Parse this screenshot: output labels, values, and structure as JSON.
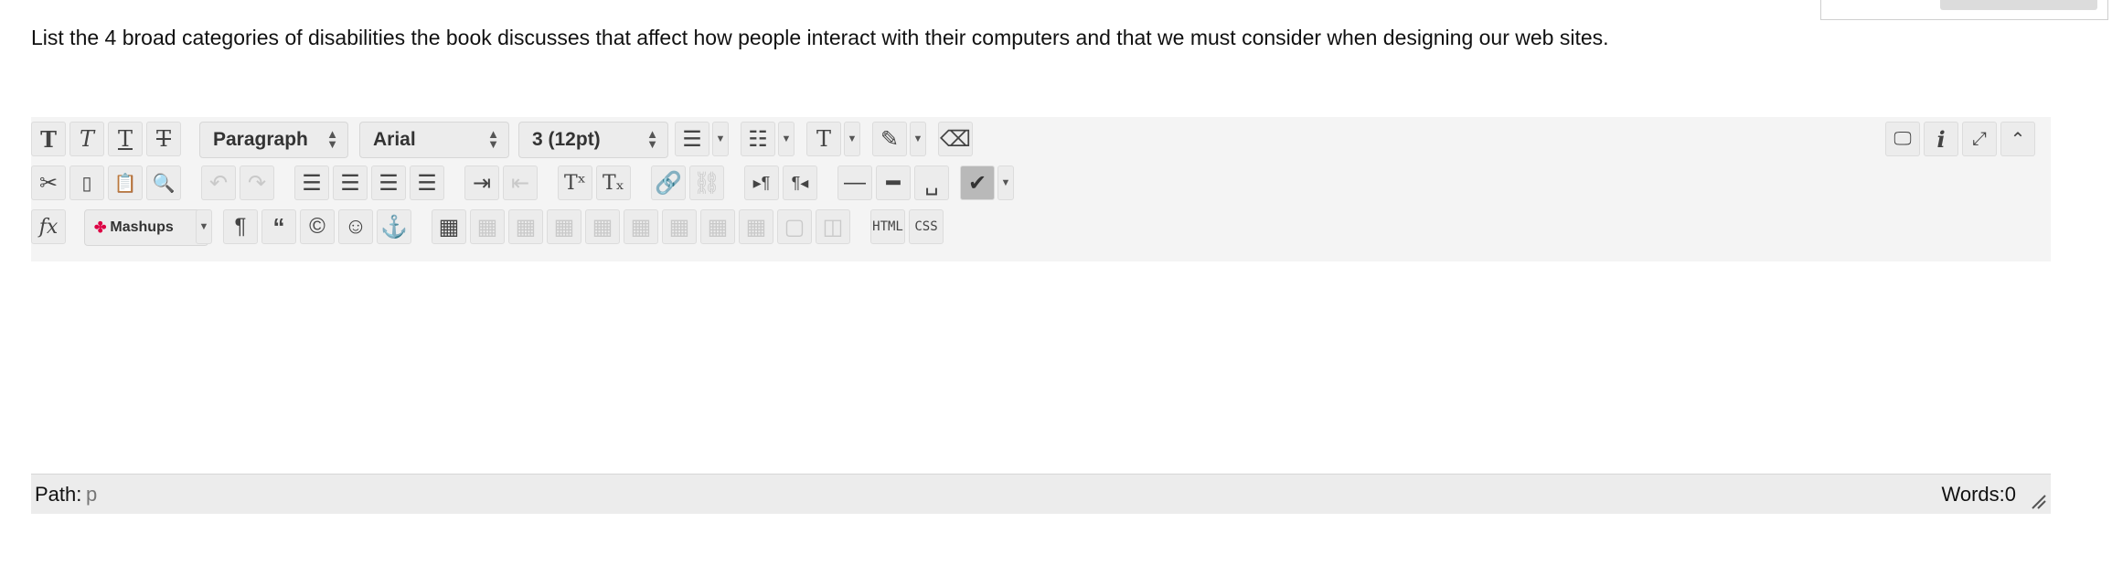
{
  "question": "List the 4 broad categories of disabilities the book discusses that affect how people interact with their computers and that we must consider when designing our web sites.",
  "toolbar": {
    "format_select": "Paragraph",
    "font_select": "Arial",
    "size_select": "3 (12pt)",
    "mashups_label": "Mashups",
    "html_label": "HTML",
    "css_label": "CSS"
  },
  "status": {
    "path_label": "Path:",
    "path_value": "p",
    "words_label": "Words:0"
  },
  "icons": [
    "bold-icon",
    "italic-icon",
    "underline-icon",
    "strikethrough-icon",
    "bullet-list-icon",
    "numbered-list-icon",
    "text-color-icon",
    "highlight-icon",
    "eraser-icon",
    "preview-icon",
    "info-icon",
    "fullscreen-icon",
    "collapse-icon",
    "cut-icon",
    "copy-icon",
    "paste-icon",
    "find-icon",
    "undo-icon",
    "redo-icon",
    "align-left-icon",
    "align-center-icon",
    "align-right-icon",
    "justify-icon",
    "indent-icon",
    "outdent-icon",
    "superscript-icon",
    "subscript-icon",
    "link-icon",
    "unlink-icon",
    "ltr-icon",
    "rtl-icon",
    "horizontal-rule-icon",
    "nonbreaking-space-icon",
    "spellcheck-icon",
    "formula-icon",
    "paragraph-mark-icon",
    "blockquote-icon",
    "copyright-icon",
    "emoticon-icon",
    "anchor-icon",
    "table-icons"
  ]
}
